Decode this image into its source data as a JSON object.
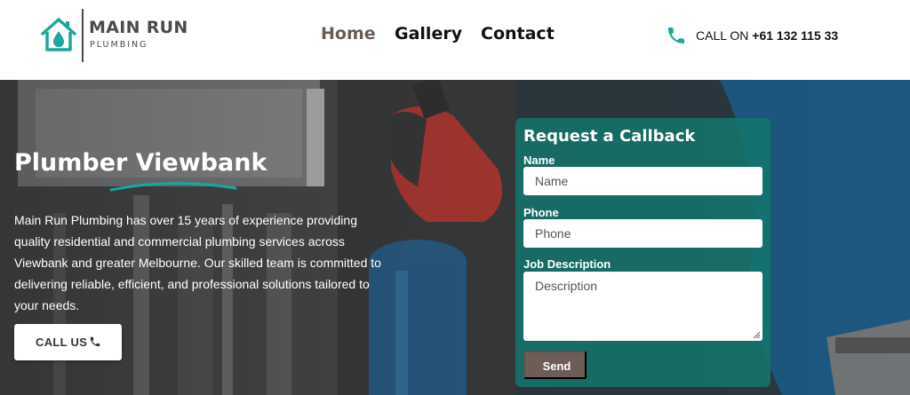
{
  "brand": {
    "name": "MAIN RUN",
    "tagline": "PLUMBING",
    "colors": {
      "teal": "#1aa79c",
      "text": "#4a4a4a",
      "nav_active": "#6a5b56",
      "send_button": "#6e5c57",
      "form_bg": "#14786e"
    }
  },
  "nav": {
    "items": [
      {
        "label": "Home",
        "active": true
      },
      {
        "label": "Gallery",
        "active": false
      },
      {
        "label": "Contact",
        "active": false
      }
    ]
  },
  "header_call": {
    "prefix": "CALL ON ",
    "number": "+61 132 115 33",
    "icon": "phone-icon"
  },
  "hero": {
    "title": "Plumber Viewbank",
    "description": "Main Run Plumbing has over 15 years of experience providing quality residential and commercial plumbing services across Viewbank and greater Melbourne. Our skilled team is committed to delivering reliable, efficient, and professional solutions tailored to your needs.",
    "call_button": {
      "label": "CALL US",
      "icon": "phone-icon"
    }
  },
  "form": {
    "title": "Request a Callback",
    "fields": {
      "name": {
        "label": "Name",
        "placeholder": "Name",
        "value": ""
      },
      "phone": {
        "label": "Phone",
        "placeholder": "Phone",
        "value": ""
      },
      "description": {
        "label": "Job Description",
        "placeholder": "Description",
        "value": ""
      }
    },
    "submit_label": "Send"
  }
}
